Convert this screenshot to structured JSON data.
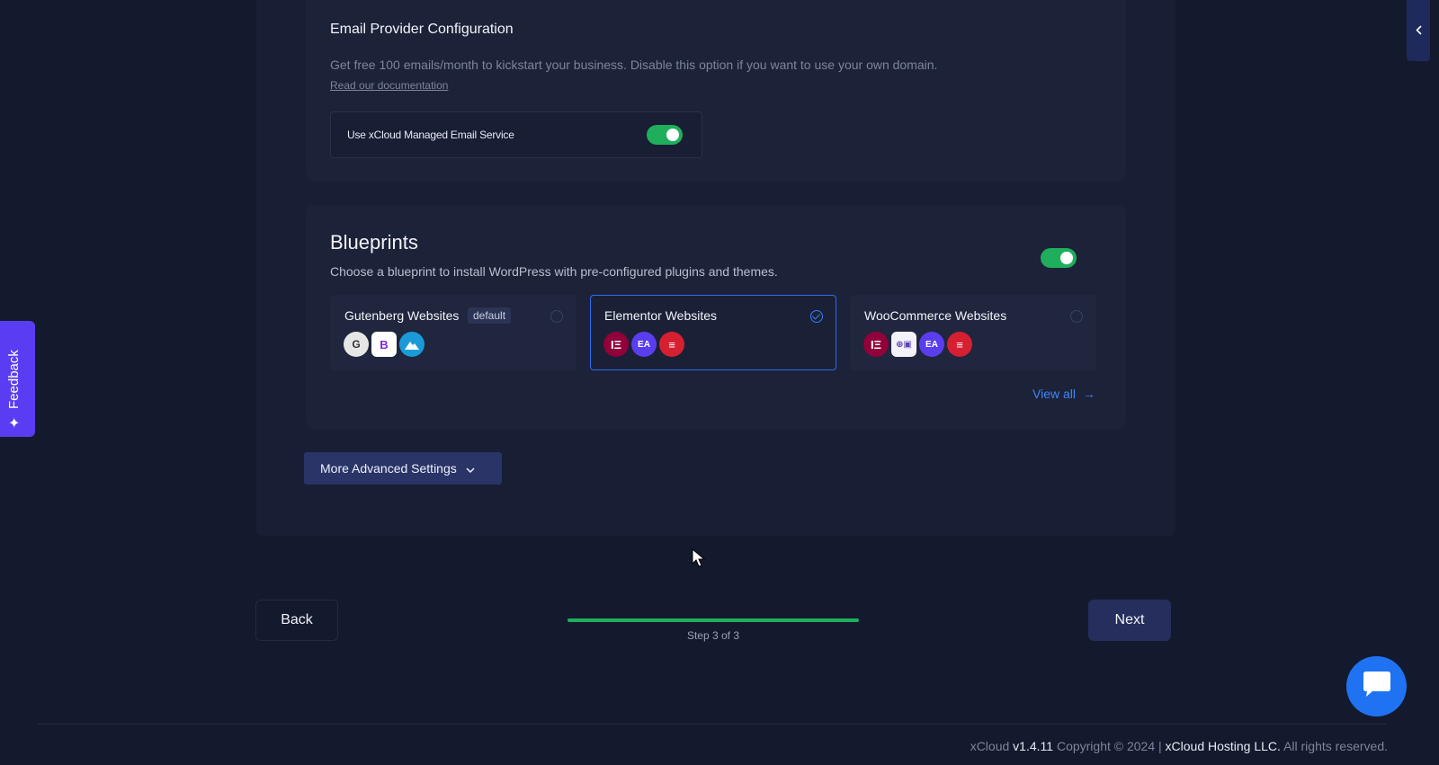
{
  "email": {
    "title": "Email Provider Configuration",
    "description": "Get free 100 emails/month to kickstart your business. Disable this option if you want to use your own domain.",
    "doc_link": "Read our documentation",
    "service_label": "Use xCloud Managed Email Service",
    "service_enabled": true
  },
  "blueprints": {
    "title": "Blueprints",
    "description": "Choose a blueprint to install WordPress with pre-configured plugins and themes.",
    "enabled": true,
    "cards": [
      {
        "name": "Gutenberg Websites",
        "badge": "default",
        "selected": false
      },
      {
        "name": "Elementor Websites",
        "selected": true
      },
      {
        "name": "WooCommerce Websites",
        "selected": false
      }
    ],
    "view_all": "View all"
  },
  "advanced": {
    "label": "More Advanced Settings"
  },
  "nav": {
    "back": "Back",
    "next": "Next",
    "step_label": "Step 3 of 3",
    "progress": 1.0
  },
  "footer": {
    "brand": "xCloud",
    "version": "v1.4.11",
    "copyright": "Copyright © 2024 |",
    "company": "xCloud Hosting LLC.",
    "rights": "All rights reserved."
  },
  "feedback": {
    "label": "Feedback"
  },
  "colors": {
    "accent_green": "#1fae5b",
    "accent_blue": "#2f6cf0",
    "feedback_purple": "#5a3df2"
  }
}
